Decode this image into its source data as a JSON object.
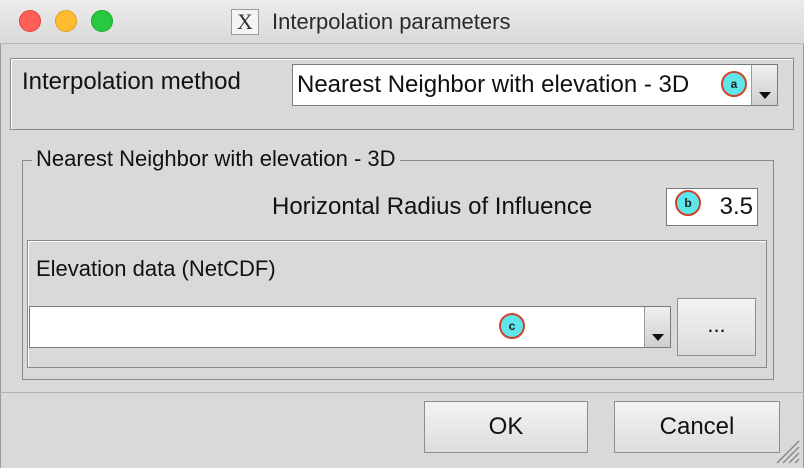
{
  "window": {
    "title": "Interpolation parameters",
    "app_icon": "X"
  },
  "method": {
    "label": "Interpolation method",
    "selected": "Nearest Neighbor with elevation - 3D"
  },
  "group": {
    "legend": "Nearest Neighbor with elevation - 3D",
    "radius_label": "Horizontal Radius of Influence",
    "radius_value": "3.5",
    "elevation_label": "Elevation data (NetCDF)",
    "elevation_value": "",
    "browse_label": "..."
  },
  "buttons": {
    "ok": "OK",
    "cancel": "Cancel"
  },
  "markers": {
    "a": "a",
    "b": "b",
    "c": "c"
  },
  "icons": {
    "close": "close-icon",
    "minimize": "minimize-icon",
    "zoom": "zoom-icon",
    "dropdown": "chevron-down-icon",
    "resize": "resize-grip-icon"
  },
  "colors": {
    "marker_fill": "#5ee6ea",
    "marker_border": "#d0432a"
  }
}
